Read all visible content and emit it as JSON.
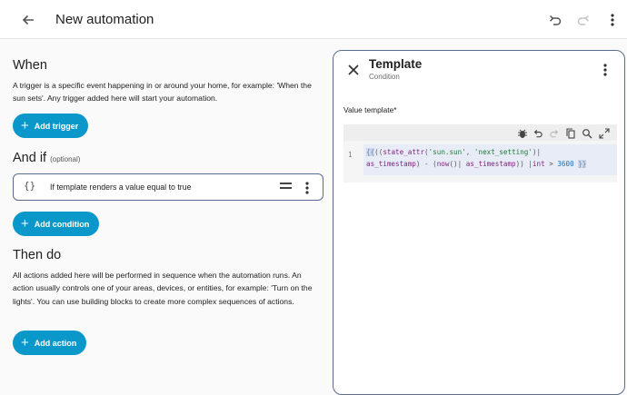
{
  "header": {
    "title": "New automation"
  },
  "when": {
    "heading": "When",
    "description": "A trigger is a specific event happening in or around your home, for example: 'When the sun sets'. Any trigger added here will start your automation.",
    "add_button": "Add trigger"
  },
  "and_if": {
    "heading": "And if",
    "optional": "(optional)",
    "condition_text": "If template renders a value equal to true",
    "condition_icon": "{}",
    "add_button": "Add condition"
  },
  "then_do": {
    "heading": "Then do",
    "description": "All actions added here will be performed in sequence when the automation runs. An action usually controls one of your areas, devices, or entities, for example: 'Turn on the lights'. You can use building blocks to create more complex sequences of actions.",
    "add_button": "Add action"
  },
  "panel": {
    "title": "Template",
    "subtitle": "Condition",
    "field_label": "Value template*",
    "line_number": "1",
    "code": {
      "open": "{{",
      "paren": "((",
      "fn": "state_attr",
      "args_open": "(",
      "str1": "'sun.sun'",
      "comma": ", ",
      "str2": "'next_setting'",
      "args_close": ")",
      "pipe1": "|",
      "line2_a": "as_timestamp",
      "line2_b": ") - (",
      "fn2": "now",
      "line2_c": "()| ",
      "line2_d": "as_timestamp",
      "line2_e": ")) |",
      "line2_f": "int",
      "line2_g": " > ",
      "num": "3600",
      "close": "}}"
    }
  },
  "colors": {
    "accent": "#0a97c9",
    "border": "#5b6b8c"
  }
}
